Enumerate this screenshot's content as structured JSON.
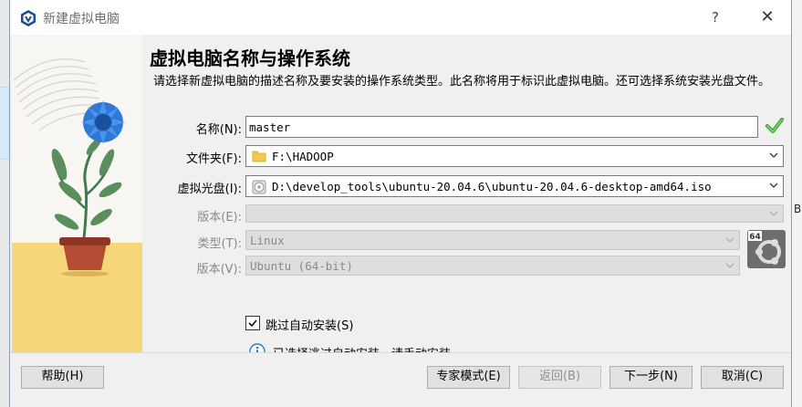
{
  "window": {
    "title": "新建虚拟电脑",
    "help_glyph": "?",
    "close_glyph": "✕"
  },
  "page": {
    "title": "虚拟电脑名称与操作系统",
    "description": "请选择新虚拟电脑的描述名称及要安装的操作系统类型。此名称将用于标识此虚拟电脑。还可选择系统安装光盘文件。"
  },
  "form": {
    "name": {
      "label": "名称(N):",
      "value": "master",
      "valid_icon": "check-icon"
    },
    "folder": {
      "label": "文件夹(F):",
      "value": "F:\\HADOOP",
      "icon": "folder-icon"
    },
    "iso": {
      "label": "虚拟光盘(I):",
      "value": "D:\\develop_tools\\ubuntu-20.04.6\\ubuntu-20.04.6-desktop-amd64.iso",
      "icon": "disc-icon"
    },
    "edition": {
      "label": "版本(E):",
      "value": "",
      "disabled": true
    },
    "type": {
      "label": "类型(T):",
      "value": "Linux",
      "disabled": true
    },
    "version": {
      "label": "版本(V):",
      "value": "Ubuntu (64-bit)",
      "disabled": true,
      "os_icon": "ubuntu-64-icon",
      "os_badge": "64"
    },
    "skip_unattended": {
      "label": "跳过自动安装(S)",
      "checked": true
    },
    "info": {
      "text": "已选择逃过自动安装，请手动安装。",
      "icon": "info-icon"
    }
  },
  "buttons": {
    "help": "帮助(H)",
    "expert": "专家模式(E)",
    "back": "返回(B)",
    "next": "下一步(N)",
    "cancel": "取消(C)"
  },
  "background": {
    "partial_letter": "B"
  },
  "colors": {
    "accent_check": "#3aa335",
    "info_blue": "#1e7ed8",
    "disabled_text": "#8a8a8a",
    "illustration_sand": "#f5d77a"
  }
}
